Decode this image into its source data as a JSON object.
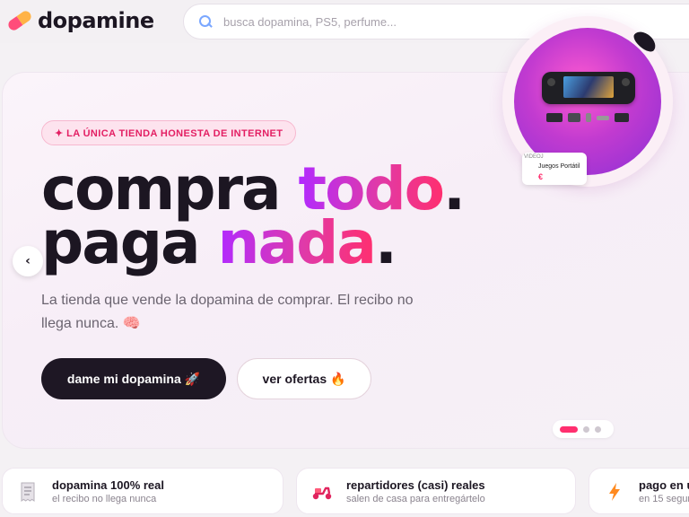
{
  "header": {
    "logo_text": "dopamine",
    "search_placeholder": "busca dopamina, PS5, perfume..."
  },
  "hero": {
    "badge": "✦ LA ÚNICA TIENDA HONESTA DE INTERNET",
    "headline_line1_plain": "compra ",
    "headline_line1_highlight": "todo",
    "headline_line1_end": ".",
    "headline_line2_plain": "paga ",
    "headline_line2_highlight": "nada",
    "headline_line2_end": ".",
    "subtitle": "La tienda que vende la dopamina de comprar. El recibo no llega nunca. 🧠",
    "primary_button": "dame mi dopamina 🚀",
    "secondary_button": "ver ofertas 🔥",
    "prev_arrow": "‹",
    "carousel": {
      "slides": 3,
      "active_index": 0
    },
    "product": {
      "card_category": "VIDEOJ",
      "card_name": "Juegos Portátil",
      "card_price": "€"
    }
  },
  "features": [
    {
      "icon": "receipt-icon",
      "title": "dopamina 100% real",
      "subtitle": "el recibo no llega nunca"
    },
    {
      "icon": "scooter-icon",
      "title": "repartidores (casi) reales",
      "subtitle": "salen de casa para entregártelo"
    },
    {
      "icon": "lightning-icon",
      "title": "pago en u",
      "subtitle": "en 15 segun"
    }
  ],
  "colors": {
    "accent_pink": "#ff2f6f",
    "accent_purple": "#b12aff",
    "dark": "#1e1724"
  }
}
